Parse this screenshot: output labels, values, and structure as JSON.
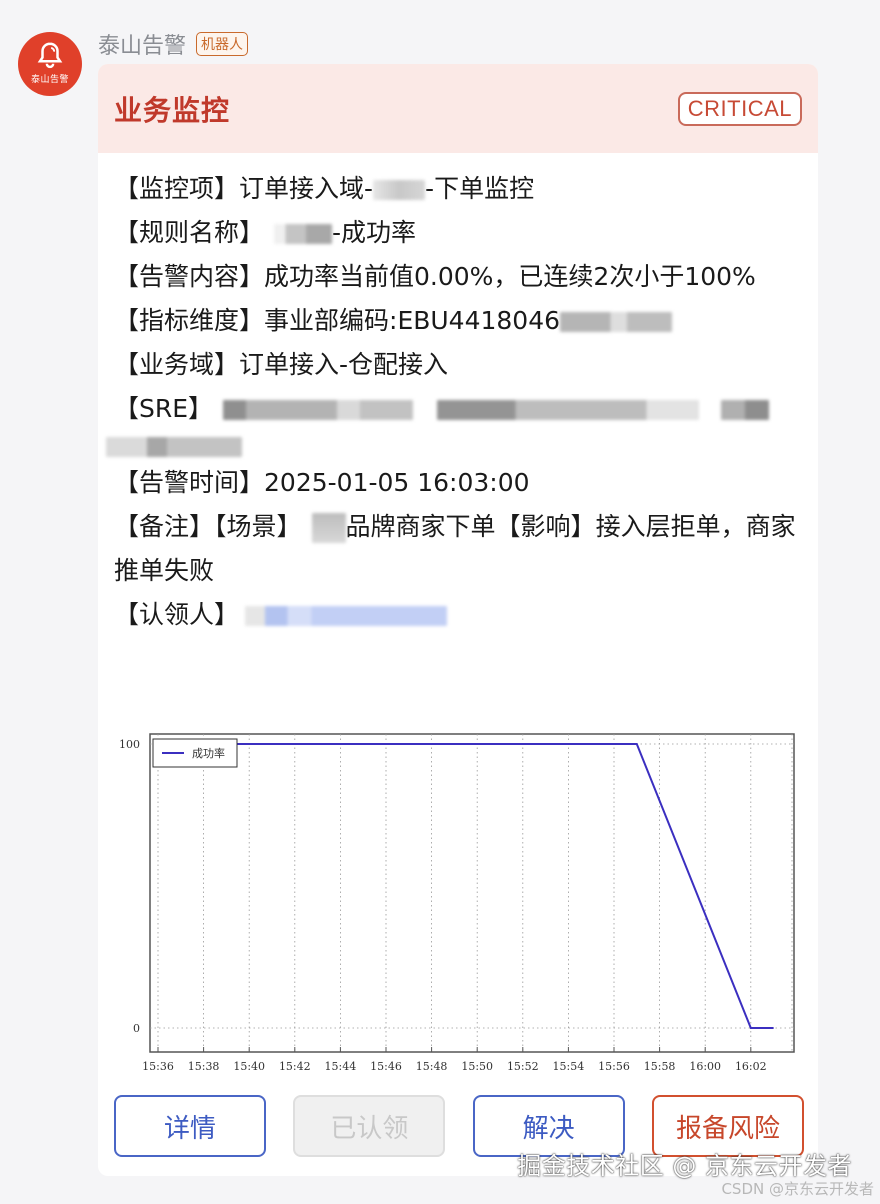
{
  "sender": {
    "avatar_icon": "bell-icon",
    "avatar_label": "泰山告警",
    "name": "泰山告警",
    "badge": "机器人"
  },
  "card": {
    "title": "业务监控",
    "severity": "CRITICAL",
    "colors": {
      "title": "#c0392b",
      "header_bg": "#fbe9e6",
      "accent_blue": "#3d5bc2",
      "accent_red": "#c7472b"
    },
    "fields": {
      "monitor_item": {
        "label": "【监控项】",
        "prefix": "订单接入域-",
        "suffix": "-下单监控"
      },
      "rule_name": {
        "label": "【规则名称】",
        "suffix": "-成功率"
      },
      "alert_content": {
        "label": "【告警内容】",
        "value": "成功率当前值0.00%，已连续2次小于100%"
      },
      "dimension": {
        "label": "【指标维度】",
        "value": "事业部编码:EBU4418046"
      },
      "business_domain": {
        "label": "【业务域】",
        "value": "订单接入-仓配接入"
      },
      "sre": {
        "label": "【SRE】"
      },
      "alert_time": {
        "label": "【告警时间】",
        "value": "2025-01-05 16:03:00"
      },
      "remark": {
        "label": "【备注】",
        "scene_label": "【场景】",
        "scene_value": "品牌商家下单",
        "impact_label": "【影响】",
        "impact_value": "接入层拒单，商家推单失败"
      },
      "claimant": {
        "label": "【认领人】"
      }
    },
    "buttons": {
      "details": "详情",
      "claimed": "已认领",
      "resolve": "解决",
      "report_risk": "报备风险"
    }
  },
  "chart_data": {
    "type": "line",
    "title": "",
    "xlabel": "",
    "ylabel": "",
    "legend": [
      "成功率"
    ],
    "legend_position": "top-left",
    "grid": true,
    "x_ticks": [
      "15:36",
      "15:38",
      "15:40",
      "15:42",
      "15:44",
      "15:46",
      "15:48",
      "15:50",
      "15:52",
      "15:54",
      "15:56",
      "15:58",
      "16:00",
      "16:02"
    ],
    "y_ticks": [
      0,
      100
    ],
    "xlim_minutes": [
      0,
      28
    ],
    "ylim": [
      0,
      100
    ],
    "series": [
      {
        "name": "成功率",
        "color": "#3b2fc0",
        "x": [
          "15:36",
          "15:57",
          "16:02",
          "16:03"
        ],
        "x_minutes": [
          0,
          21,
          26,
          27
        ],
        "values": [
          100,
          100,
          0,
          0
        ]
      }
    ]
  },
  "watermarks": {
    "main": "掘金技术社区 @ 京东云开发者",
    "secondary": "CSDN @京东云开发者"
  }
}
